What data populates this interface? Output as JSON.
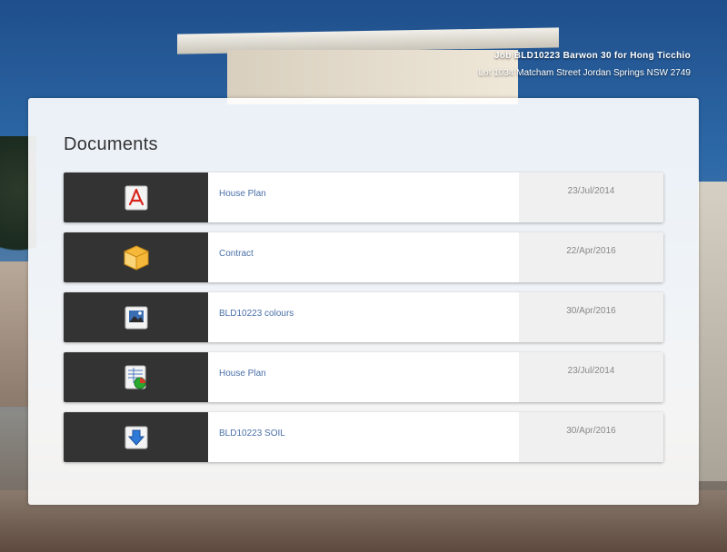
{
  "job": {
    "title": "Job BLD10223 Barwon 30 for Hong Ticchio",
    "address": "Lot 1034 Matcham Street Jordan Springs NSW 2749"
  },
  "documents": {
    "heading": "Documents",
    "items": [
      {
        "name": "House Plan",
        "date": "23/Jul/2014",
        "icon": "pdf-icon"
      },
      {
        "name": "Contract",
        "date": "22/Apr/2016",
        "icon": "package-icon"
      },
      {
        "name": "BLD10223 colours",
        "date": "30/Apr/2016",
        "icon": "image-icon"
      },
      {
        "name": "House Plan",
        "date": "23/Jul/2014",
        "icon": "spreadsheet-chart-icon"
      },
      {
        "name": "BLD10223 SOIL",
        "date": "30/Apr/2016",
        "icon": "download-icon"
      }
    ]
  },
  "colors": {
    "icon_cell": "#333333",
    "link": "#4a6fa8",
    "date": "#888888"
  }
}
